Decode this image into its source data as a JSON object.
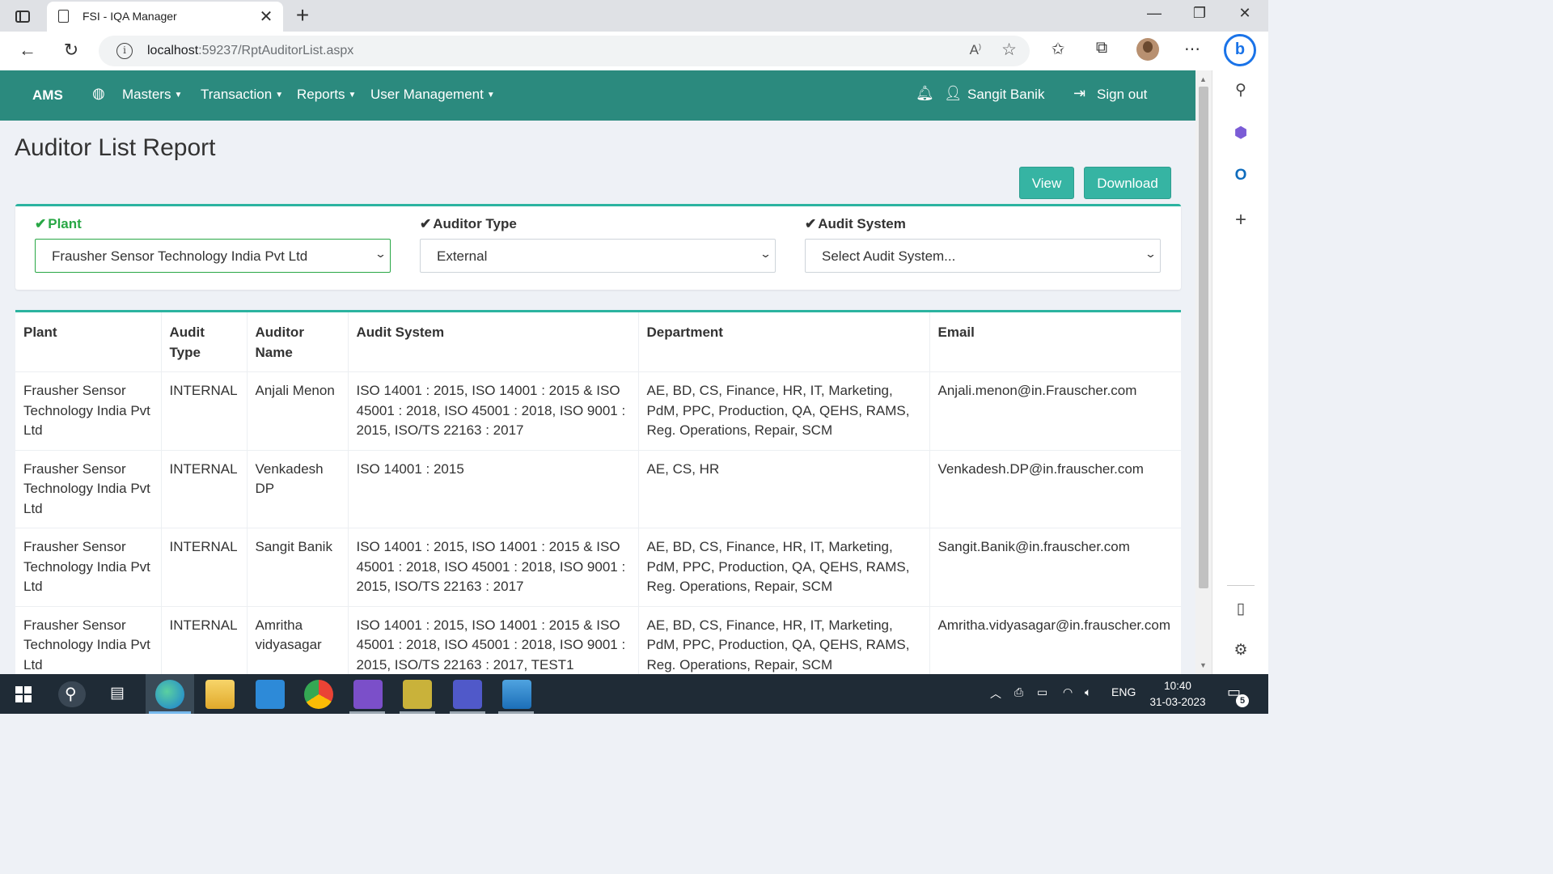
{
  "browser": {
    "tab_title": "FSI - IQA Manager",
    "url_host": "localhost",
    "url_rest": ":59237/RptAuditorList.aspx"
  },
  "navbar": {
    "brand": "AMS",
    "items": [
      {
        "label": "Masters"
      },
      {
        "label": "Transaction"
      },
      {
        "label": "Reports"
      },
      {
        "label": "User Management"
      }
    ],
    "user_name": "Sangit Banik",
    "sign_out": "Sign out"
  },
  "page": {
    "title": "Auditor List Report",
    "view_button": "View",
    "download_button": "Download"
  },
  "filters": {
    "plant": {
      "label": "Plant",
      "value": "Frausher Sensor Technology India Pvt Ltd"
    },
    "auditor_type": {
      "label": "Auditor Type",
      "value": "External"
    },
    "audit_system": {
      "label": "Audit System",
      "value": "Select Audit System..."
    }
  },
  "table": {
    "headers": [
      "Plant",
      "Audit Type",
      "Auditor Name",
      "Audit System",
      "Department",
      "Email"
    ],
    "rows": [
      [
        "Frausher Sensor Technology India Pvt Ltd",
        "INTERNAL",
        "Anjali Menon",
        "ISO 14001 : 2015, ISO 14001 : 2015 & ISO 45001 : 2018, ISO 45001 : 2018, ISO 9001 : 2015, ISO/TS 22163 : 2017",
        "AE, BD, CS, Finance, HR, IT, Marketing, PdM, PPC, Production, QA, QEHS, RAMS, Reg. Operations, Repair, SCM",
        "Anjali.menon@in.Frauscher.com"
      ],
      [
        "Frausher Sensor Technology India Pvt Ltd",
        "INTERNAL",
        "Venkadesh DP",
        "ISO 14001 : 2015",
        "AE, CS, HR",
        "Venkadesh.DP@in.frauscher.com"
      ],
      [
        "Frausher Sensor Technology India Pvt Ltd",
        "INTERNAL",
        "Sangit Banik",
        "ISO 14001 : 2015, ISO 14001 : 2015 & ISO 45001 : 2018, ISO 45001 : 2018, ISO 9001 : 2015, ISO/TS 22163 : 2017",
        "AE, BD, CS, Finance, HR, IT, Marketing, PdM, PPC, Production, QA, QEHS, RAMS, Reg. Operations, Repair, SCM",
        "Sangit.Banik@in.frauscher.com"
      ],
      [
        "Frausher Sensor Technology India Pvt Ltd",
        "INTERNAL",
        "Amritha vidyasagar",
        "ISO 14001 : 2015, ISO 14001 : 2015 & ISO 45001 : 2018, ISO 45001 : 2018, ISO 9001 : 2015, ISO/TS 22163 : 2017, TEST1",
        "AE, BD, CS, Finance, HR, IT, Marketing, PdM, PPC, Production, QA, QEHS, RAMS, Reg. Operations, Repair, SCM",
        "Amritha.vidyasagar@in.frauscher.com"
      ]
    ]
  },
  "taskbar": {
    "language": "ENG",
    "time": "10:40",
    "date": "31-03-2023",
    "notification_count": "5"
  },
  "colors": {
    "navbar": "#2b8a7e",
    "accent": "#36b4a3",
    "valid": "#28a745"
  }
}
